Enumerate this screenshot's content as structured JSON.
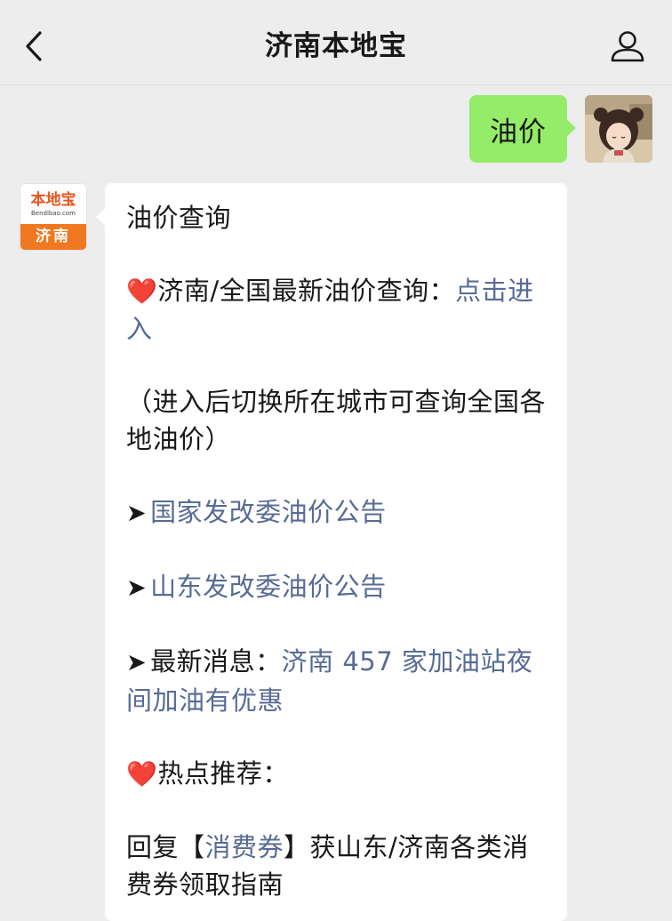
{
  "header": {
    "title": "济南本地宝"
  },
  "outgoing": {
    "text": "油价"
  },
  "bot": {
    "avatar_logo": "本地宝",
    "avatar_url": "Bendibao.com",
    "avatar_city": "济南"
  },
  "message": {
    "title": "油价查询",
    "line1_heart": "❤️",
    "line1_text": "济南/全国最新油价查询：",
    "line1_link": "点击进入",
    "line2_text": "（进入后切换所在城市可查询全国各地油价）",
    "line3_arrow": "➤",
    "line3_link": "国家发改委油价公告",
    "line4_arrow": "➤",
    "line4_link": "山东发改委油价公告",
    "line5_arrow": "➤",
    "line5_text": "最新消息：",
    "line5_link": "济南 457 家加油站夜间加油有优惠",
    "line6_heart": "❤️",
    "line6_text": "热点推荐：",
    "line7_prefix": "回复【",
    "line7_link": "消费券",
    "line7_suffix": "】获山东/济南各类消费券领取指南"
  },
  "colors": {
    "background": "#ededed",
    "outgoing_bubble": "#95ec69",
    "incoming_bubble": "#ffffff",
    "link": "#576b95",
    "brand_orange": "#f07820"
  },
  "icons": {
    "back": "chevron-left-icon",
    "profile": "user-icon"
  }
}
